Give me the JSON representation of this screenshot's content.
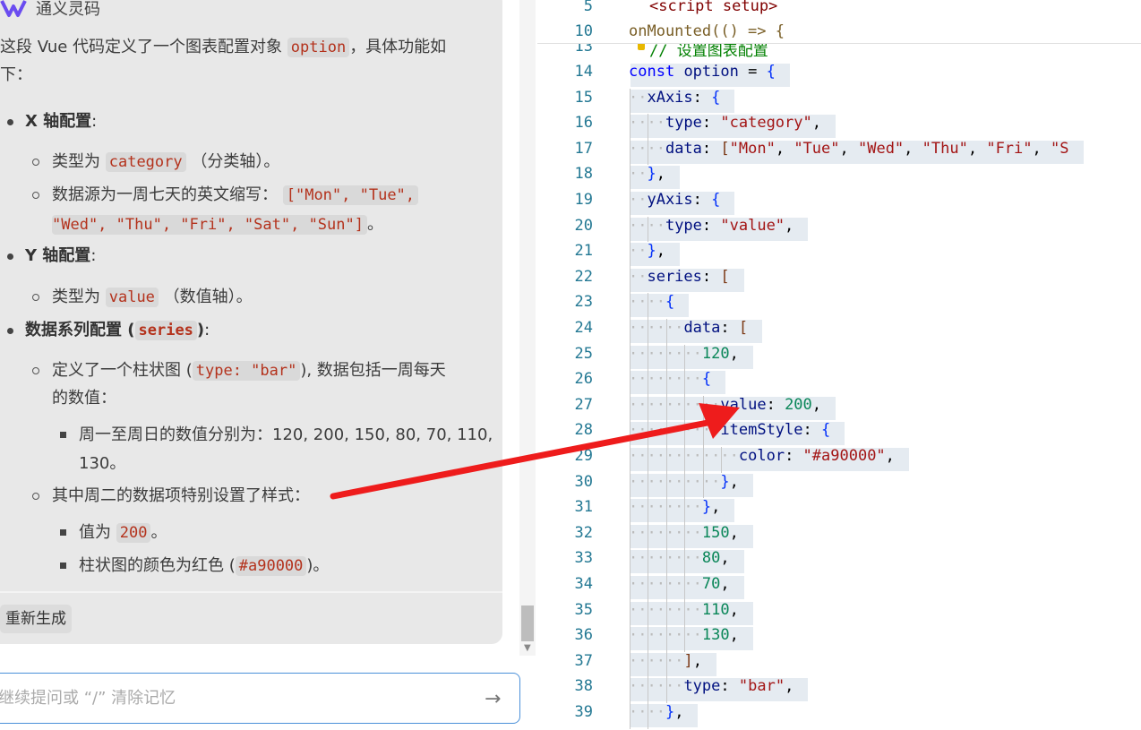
{
  "chat": {
    "brand": "通义灵码",
    "intro": "这段 Vue 代码定义了一个图表配置对象",
    "intro_code": "option",
    "intro_tail": "，具体功能如",
    "intro_wrap": "下：",
    "x_title": "X 轴配置",
    "x_item1_pre": "类型为",
    "x_item1_code": "category",
    "x_item1_post": "（分类轴）。",
    "x_item2_pre": "数据源为一周七天的英文缩写：",
    "x_item2_code1": "[\"Mon\", \"Tue\",",
    "x_item2_code2": "\"Wed\", \"Thu\", \"Fri\", \"Sat\", \"Sun\"]",
    "x_item2_post": "。",
    "y_title": "Y 轴配置",
    "y_item1_pre": "类型为",
    "y_item1_code": "value",
    "y_item1_post": "（数值轴）。",
    "s_title_pre": "数据系列配置 (",
    "s_title_code": "series",
    "s_title_post": ")",
    "colon": ":",
    "s_item1_pre": "定义了一个柱状图 (",
    "s_item1_code": "type: \"bar\"",
    "s_item1_post": "), 数据包括一周每天",
    "s_item1_wrap": "的数值：",
    "s_sub1": "周一至周日的数值分别为：120, 200, 150, 80, 70, 110,",
    "s_sub1_wrap": "130。",
    "s_item2": "其中周二的数据项特别设置了样式：",
    "s_sub2_pre": "值为",
    "s_sub2_code": "200",
    "s_sub2_post": "。",
    "s_sub3_pre": "柱状图的颜色为红色 (",
    "s_sub3_code": "#a90000",
    "s_sub3_post": ")。",
    "regenerate": "重新生成",
    "input_placeholder": "继续提问或 “/” 清除记忆",
    "send_icon": "→"
  },
  "editor": {
    "sticky": [
      {
        "ln": "5",
        "text": "<script setup>"
      },
      {
        "ln": "10",
        "text": "onMounted(() => {"
      }
    ],
    "partial_line": {
      "ln": "13",
      "text": "// 设置图表配置"
    },
    "lines": [
      {
        "ln": "14",
        "text": "const option = {"
      },
      {
        "ln": "15",
        "text": "xAxis: {"
      },
      {
        "ln": "16",
        "text": "type: \"category\","
      },
      {
        "ln": "17",
        "text": "data: [\"Mon\", \"Tue\", \"Wed\", \"Thu\", \"Fri\", \"S"
      },
      {
        "ln": "18",
        "text": "},"
      },
      {
        "ln": "19",
        "text": "yAxis: {"
      },
      {
        "ln": "20",
        "text": "type: \"value\","
      },
      {
        "ln": "21",
        "text": "},"
      },
      {
        "ln": "22",
        "text": "series: ["
      },
      {
        "ln": "23",
        "text": "{"
      },
      {
        "ln": "24",
        "text": "data: ["
      },
      {
        "ln": "25",
        "text": "120,"
      },
      {
        "ln": "26",
        "text": "{"
      },
      {
        "ln": "27",
        "text": "value: 200,"
      },
      {
        "ln": "28",
        "text": "itemStyle: {"
      },
      {
        "ln": "29",
        "text": "color: \"#a90000\","
      },
      {
        "ln": "30",
        "text": "},"
      },
      {
        "ln": "31",
        "text": "},"
      },
      {
        "ln": "32",
        "text": "150,"
      },
      {
        "ln": "33",
        "text": "80,"
      },
      {
        "ln": "34",
        "text": "70,"
      },
      {
        "ln": "35",
        "text": "110,"
      },
      {
        "ln": "36",
        "text": "130,"
      },
      {
        "ln": "37",
        "text": "],"
      },
      {
        "ln": "38",
        "text": "type: \"bar\","
      },
      {
        "ln": "39",
        "text": "},"
      }
    ]
  },
  "annotation": {
    "arrow_color": "#ee1c1c"
  }
}
